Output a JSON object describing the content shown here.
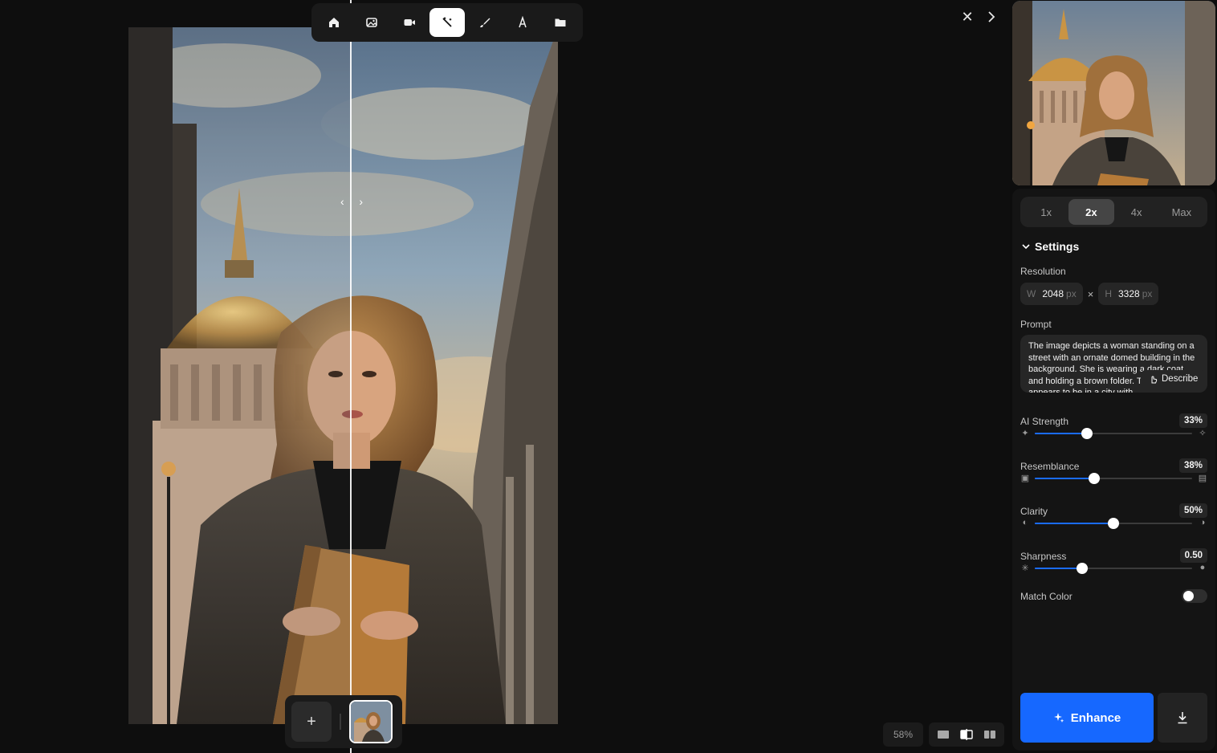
{
  "toolbar": {
    "tools": [
      {
        "name": "home",
        "icon": "home-icon"
      },
      {
        "name": "image",
        "icon": "image-icon"
      },
      {
        "name": "video",
        "icon": "video-icon"
      },
      {
        "name": "enhance",
        "icon": "magic-wand-icon",
        "active": true
      },
      {
        "name": "edit",
        "icon": "brush-icon"
      },
      {
        "name": "text",
        "icon": "text-icon"
      },
      {
        "name": "assets",
        "icon": "folder-icon"
      }
    ]
  },
  "canvas": {
    "zoom": "58%",
    "add_label": "+"
  },
  "panel": {
    "scales": [
      "1x",
      "2x",
      "4x",
      "Max"
    ],
    "active_scale": "2x",
    "settings_title": "Settings",
    "resolution_label": "Resolution",
    "width_prefix": "W",
    "width": "2048",
    "height_prefix": "H",
    "height": "3328",
    "unit": "px",
    "times": "×",
    "prompt_label": "Prompt",
    "prompt_text": "The image depicts a woman standing on a street with an ornate domed building in the background. She is wearing a dark coat and holding a brown folder. The setting appears to be in a city with",
    "describe_label": "Describe",
    "sliders": [
      {
        "label": "AI Strength",
        "value": "33%",
        "fraction": 0.33
      },
      {
        "label": "Resemblance",
        "value": "38%",
        "fraction": 0.38
      },
      {
        "label": "Clarity",
        "value": "50%",
        "fraction": 0.5
      },
      {
        "label": "Sharpness",
        "value": "0.50",
        "fraction": 0.3
      }
    ],
    "match_color_label": "Match Color",
    "match_color_on": false,
    "enhance_label": "Enhance"
  },
  "colors": {
    "accent": "#1668ff",
    "background": "#0d0d0d"
  }
}
